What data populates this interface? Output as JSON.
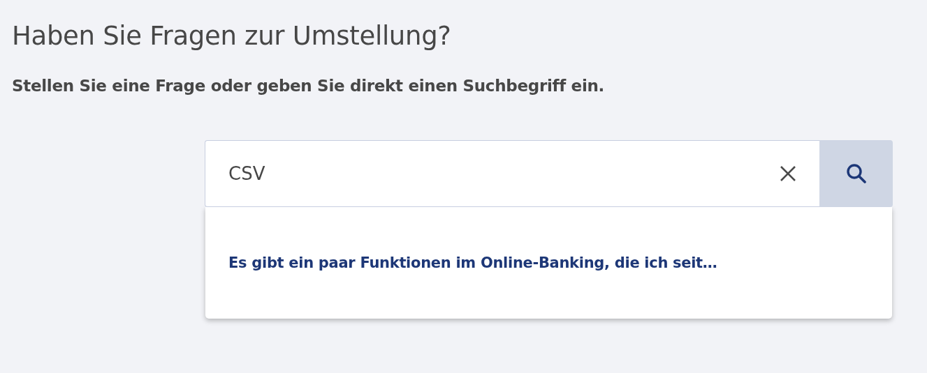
{
  "heading": "Haben Sie Fragen zur Umstellung?",
  "subheading": "Stellen Sie eine Frage oder geben Sie direkt einen Suchbegriff ein.",
  "search": {
    "value": "CSV"
  },
  "suggestions": [
    {
      "text": "Es gibt ein paar Funktionen im Online-Banking, die ich seit…"
    }
  ]
}
